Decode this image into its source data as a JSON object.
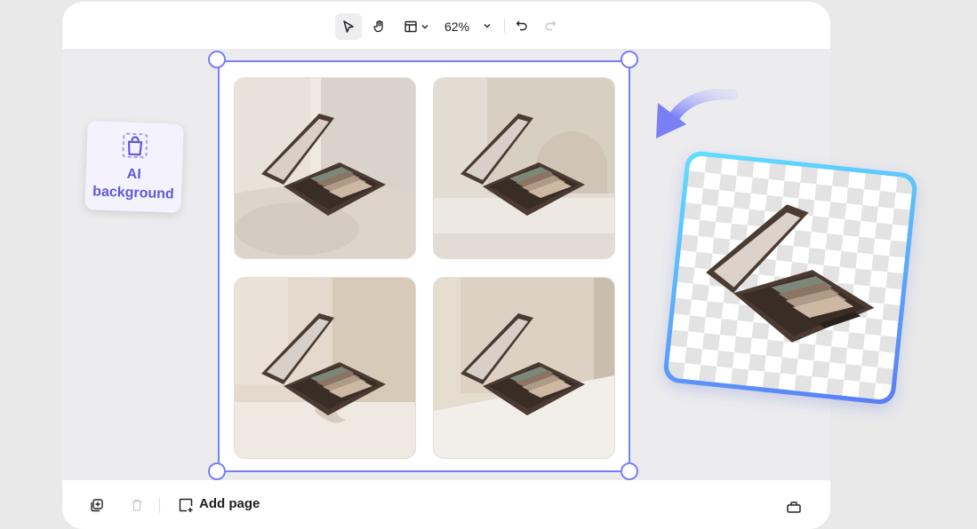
{
  "toolbar": {
    "zoom_level": "62%",
    "tools": [
      "select-tool",
      "hand-tool",
      "layout-tool",
      "undo",
      "redo"
    ]
  },
  "bottom_bar": {
    "add_page_label": "Add page"
  },
  "ai_card": {
    "label_line1": "AI",
    "label_line2": "background"
  },
  "colors": {
    "selection": "#7b7ff5",
    "accent_purple": "#6458d8",
    "arrow": "#7b7ff5",
    "card_gradient_start": "#5fe0ff",
    "card_gradient_end": "#5a7cf5"
  },
  "images": {
    "grid": [
      "eyeshadow-palette-render-1",
      "eyeshadow-palette-render-2",
      "eyeshadow-palette-render-3",
      "eyeshadow-palette-render-4"
    ],
    "cutout": "eyeshadow-palette-transparent-cutout"
  }
}
